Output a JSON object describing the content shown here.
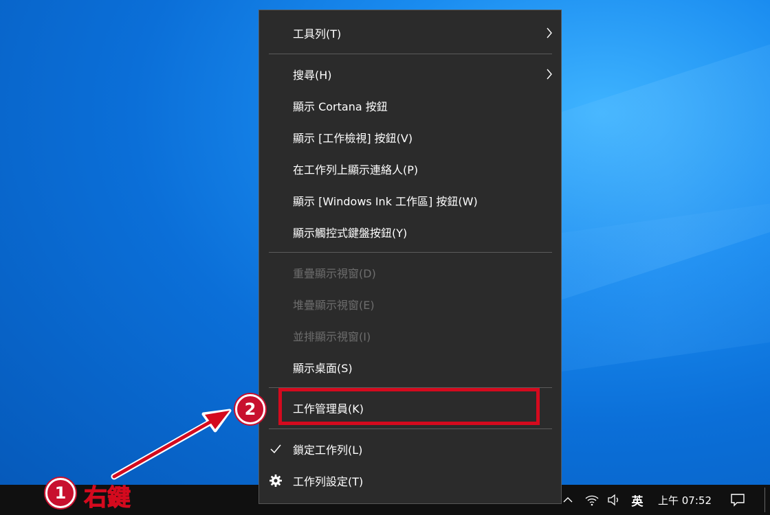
{
  "colors": {
    "menu_bg": "#2b2b2b",
    "menu_text": "#ffffff",
    "menu_disabled_text": "#6d6d6d",
    "taskbar_bg": "#101010",
    "annotation_red": "#d40a1e"
  },
  "context_menu": {
    "items": [
      {
        "label": "工具列(T)",
        "submenu": true,
        "enabled": true
      },
      {
        "label": "搜尋(H)",
        "submenu": true,
        "enabled": true
      },
      {
        "label": "顯示 Cortana 按鈕",
        "enabled": true
      },
      {
        "label": "顯示 [工作檢視] 按鈕(V)",
        "enabled": true
      },
      {
        "label": "在工作列上顯示連絡人(P)",
        "enabled": true
      },
      {
        "label": "顯示 [Windows Ink 工作區] 按鈕(W)",
        "enabled": true
      },
      {
        "label": "顯示觸控式鍵盤按鈕(Y)",
        "enabled": true
      },
      {
        "label": "重疊顯示視窗(D)",
        "enabled": false
      },
      {
        "label": "堆疊顯示視窗(E)",
        "enabled": false
      },
      {
        "label": "並排顯示視窗(I)",
        "enabled": false
      },
      {
        "label": "顯示桌面(S)",
        "enabled": true
      },
      {
        "label": "工作管理員(K)",
        "enabled": true,
        "highlighted": true
      },
      {
        "label": "鎖定工作列(L)",
        "enabled": true,
        "icon": "checkmark-icon",
        "checked": true
      },
      {
        "label": "工作列設定(T)",
        "enabled": true,
        "icon": "gear-icon"
      }
    ]
  },
  "taskbar": {
    "ime_label": "英",
    "clock": "上午 07:52",
    "icons": [
      "chevron-up-icon",
      "wifi-icon",
      "volume-icon",
      "notification-icon"
    ]
  },
  "annotations": {
    "step1_number": "1",
    "step1_text": "右鍵",
    "step2_number": "2"
  }
}
